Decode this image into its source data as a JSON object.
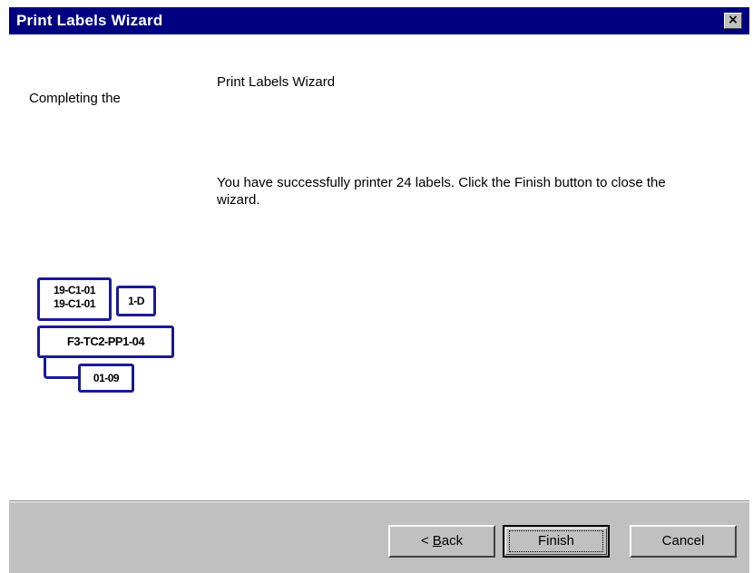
{
  "window": {
    "title": "Print Labels Wizard",
    "close_glyph": "×"
  },
  "left_panel": {
    "heading": "Completing the"
  },
  "right_panel": {
    "title": "Print Labels Wizard",
    "message": "You have successfully printer 24 labels. Click the Finish button to close the wizard."
  },
  "graphic": {
    "label_top_line1": "19-C1-01",
    "label_top_line2": "19-C1-01",
    "label_small": "1-D",
    "label_main": "F3-TC2-PP1-04",
    "label_bottom": "01-09",
    "label_border_color": "#1a1a99"
  },
  "buttons": {
    "back_prefix": "< ",
    "back_mnemonic": "B",
    "back_rest": "ack",
    "finish": "Finish",
    "cancel": "Cancel"
  },
  "colors": {
    "titlebar": "#000080",
    "face": "#c0c0c0"
  }
}
